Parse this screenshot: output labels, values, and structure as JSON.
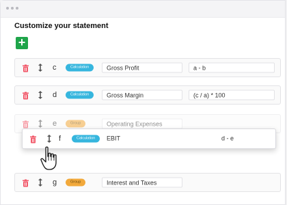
{
  "window": {
    "title_dots": 3
  },
  "page": {
    "heading": "Customize your statement",
    "add_button_label": "+"
  },
  "colors": {
    "add_button": "#1fa54a",
    "trash": "#f15a6b",
    "calculation_badge": "#36b6de",
    "group_badge": "#f2a93b"
  },
  "rows": [
    {
      "letter": "c",
      "type": "Calculation",
      "name": "Gross Profit",
      "formula": "a - b"
    },
    {
      "letter": "d",
      "type": "Calculation",
      "name": "Gross Margin",
      "formula": "(c / a) * 100"
    },
    {
      "letter": "e",
      "type": "Group",
      "name": "Operating Expenses",
      "formula": ""
    },
    {
      "letter": "f",
      "type": "Calculation",
      "name": "EBIT",
      "formula": "d - e",
      "state": "dragging"
    },
    {
      "letter": "g",
      "type": "Group",
      "name": "Interest and Taxes",
      "formula": ""
    }
  ],
  "icons": {
    "delete": "trash-icon",
    "reorder": "drag-handle-icon",
    "add": "plus-icon",
    "pointer": "hand-pointer-icon"
  }
}
